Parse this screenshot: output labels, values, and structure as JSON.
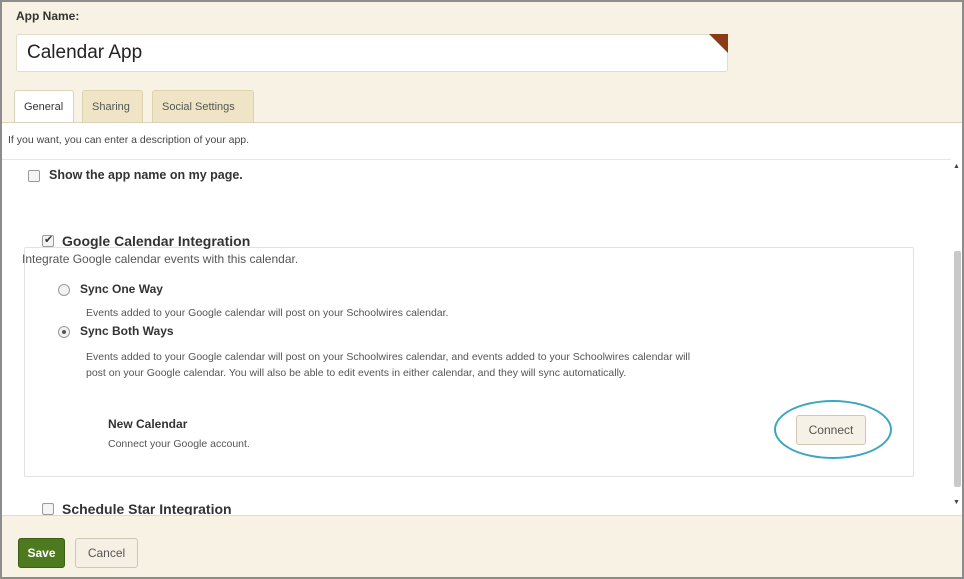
{
  "header": {
    "app_name_label": "App Name:",
    "app_name_value": "Calendar App"
  },
  "tabs": [
    {
      "label": "General",
      "active": true
    },
    {
      "label": "Sharing",
      "active": false
    },
    {
      "label": "Social Settings",
      "active": false
    }
  ],
  "general": {
    "description_hint": "If you want, you can enter a description of your app.",
    "show_app_name": {
      "label": "Show the app name on my page.",
      "checked": false
    },
    "google_integration": {
      "title": "Google Calendar Integration",
      "checked": true,
      "description": "Integrate Google calendar events with this calendar.",
      "options": [
        {
          "label": "Sync One Way",
          "selected": false,
          "description": "Events added to your Google calendar will post on your Schoolwires calendar."
        },
        {
          "label": "Sync Both Ways",
          "selected": true,
          "description": "Events added to your Google calendar will post on your Schoolwires calendar, and events added to your Schoolwires calendar will post on your Google calendar. You will also be able to edit events in either calendar, and they will sync automatically."
        }
      ],
      "new_calendar": {
        "title": "New Calendar",
        "description": "Connect your Google account.",
        "connect_label": "Connect"
      }
    },
    "schedule_star": {
      "title": "Schedule Star Integration",
      "checked": false
    }
  },
  "footer": {
    "save_label": "Save",
    "cancel_label": "Cancel"
  },
  "colors": {
    "header_bg": "#f7f2e3",
    "save_bg": "#4d7a1e",
    "highlight_ring": "#3aa6c0",
    "corner_mark": "#8a3a17"
  }
}
